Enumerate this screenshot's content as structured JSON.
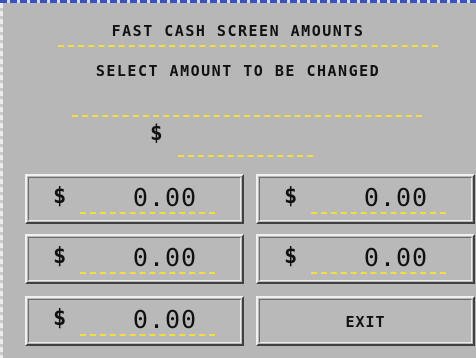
{
  "header": {
    "title": "FAST CASH SCREEN AMOUNTS",
    "subtitle": "SELECT AMOUNT TO BE CHANGED"
  },
  "entry": {
    "currency_symbol": "$"
  },
  "amounts": [
    {
      "currency_symbol": "$",
      "value": "0.00"
    },
    {
      "currency_symbol": "$",
      "value": "0.00"
    },
    {
      "currency_symbol": "$",
      "value": "0.00"
    },
    {
      "currency_symbol": "$",
      "value": "0.00"
    },
    {
      "currency_symbol": "$",
      "value": "0.00"
    }
  ],
  "exit_button": {
    "label": "EXIT"
  },
  "colors": {
    "background": "#b7b7b7",
    "field_underline": "#f0df3c",
    "top_rule": "#3a4fc0"
  }
}
